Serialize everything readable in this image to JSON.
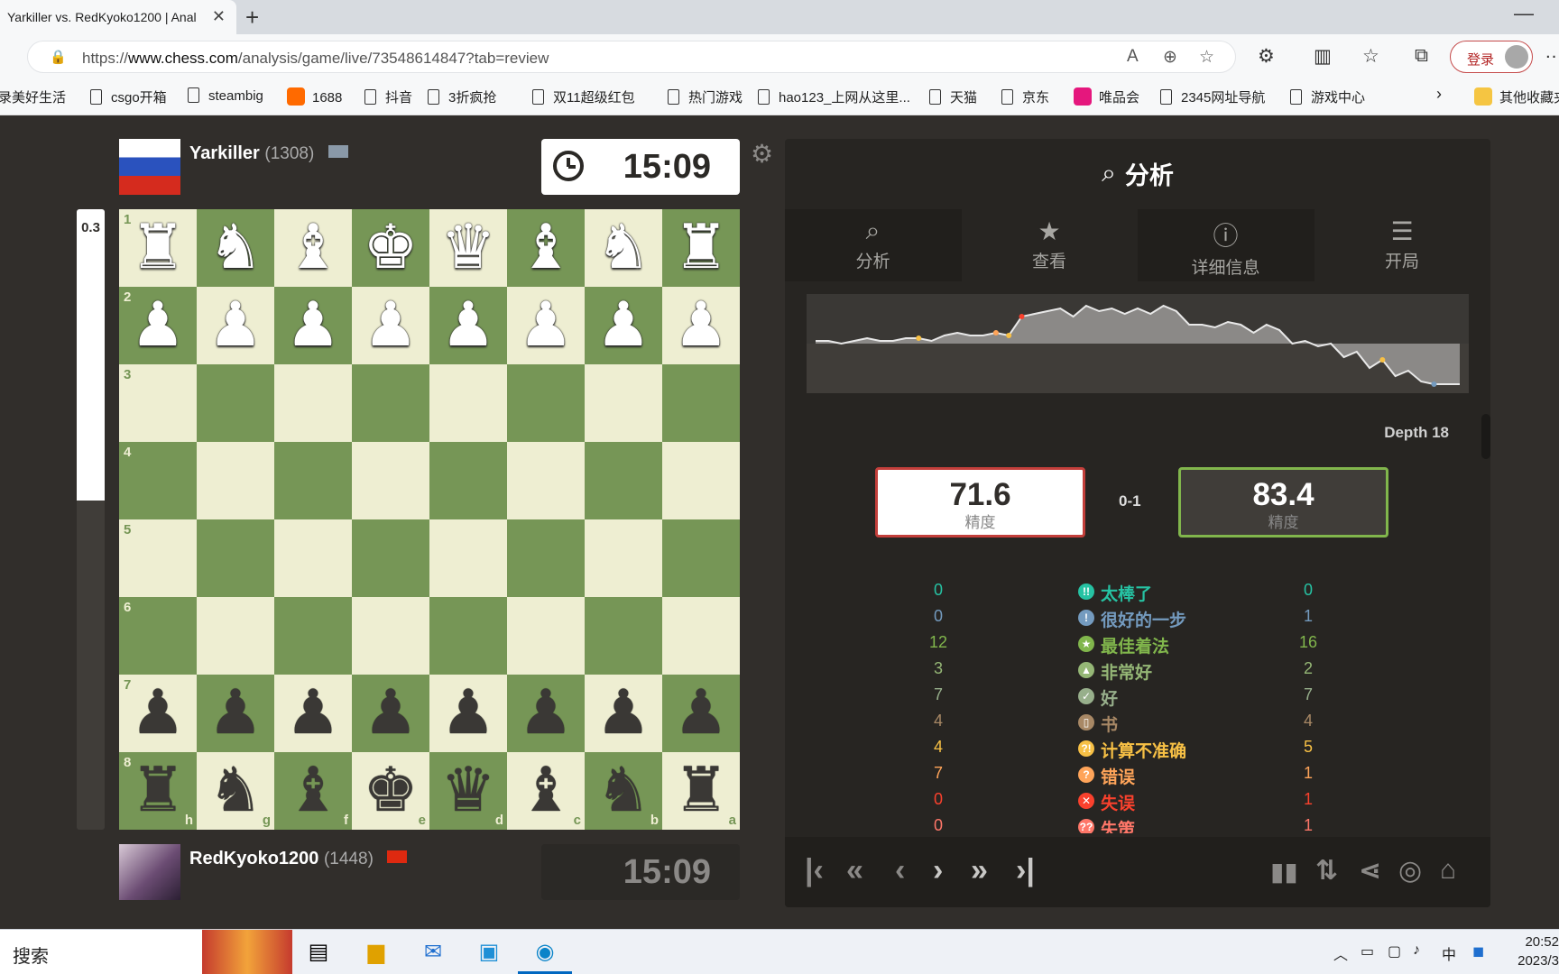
{
  "browser": {
    "tab_title": "Yarkiller vs. RedKyoko1200 | Anal",
    "url_prefix": "https://",
    "url_host": "www.chess.com",
    "url_path": "/analysis/game/live/73548614847?tab=review",
    "login_label": "登录",
    "bookmarks": [
      {
        "label": "录美好生活",
        "icon": "none"
      },
      {
        "label": "csgo开箱",
        "icon": "page-icon"
      },
      {
        "label": "steambig",
        "icon": "page-icon"
      },
      {
        "label": "1688",
        "icon": "1688-logo"
      },
      {
        "label": "抖音",
        "icon": "page-icon"
      },
      {
        "label": "3折疯抢",
        "icon": "page-icon"
      },
      {
        "label": "双11超级红包",
        "icon": "page-icon"
      },
      {
        "label": "热门游戏",
        "icon": "page-icon"
      },
      {
        "label": "hao123_上网从这里...",
        "icon": "page-icon"
      },
      {
        "label": "天猫",
        "icon": "page-icon"
      },
      {
        "label": "京东",
        "icon": "page-icon"
      },
      {
        "label": "唯品会",
        "icon": "vip-logo"
      },
      {
        "label": "2345网址导航",
        "icon": "page-icon"
      },
      {
        "label": "游戏中心",
        "icon": "page-icon"
      }
    ],
    "other_bookmarks": "其他收藏夹"
  },
  "top_player": {
    "name": "Yarkiller",
    "rating": "(1308)",
    "clock": "15:09"
  },
  "bottom_player": {
    "name": "RedKyoko1200",
    "rating": "(1448)",
    "clock": "15:09"
  },
  "eval": {
    "value": "0.3",
    "white_fraction": 0.47
  },
  "board": {
    "orientation": "black",
    "ranks": [
      "1",
      "2",
      "3",
      "4",
      "5",
      "6",
      "7",
      "8"
    ],
    "files": [
      "h",
      "g",
      "f",
      "e",
      "d",
      "c",
      "b",
      "a"
    ],
    "rows": [
      [
        "♜",
        "♞",
        "♝",
        "♚",
        "♛",
        "♝",
        "♞",
        "♜"
      ],
      [
        "♟",
        "♟",
        "♟",
        "♟",
        "♟",
        "♟",
        "♟",
        "♟"
      ],
      [
        "",
        "",
        "",
        "",
        "",
        "",
        "",
        ""
      ],
      [
        "",
        "",
        "",
        "",
        "",
        "",
        "",
        ""
      ],
      [
        "",
        "",
        "",
        "",
        "",
        "",
        "",
        ""
      ],
      [
        "",
        "",
        "",
        "",
        "",
        "",
        "",
        ""
      ],
      [
        "♟",
        "♟",
        "♟",
        "♟",
        "♟",
        "♟",
        "♟",
        "♟"
      ],
      [
        "♜",
        "♞",
        "♝",
        "♚",
        "♛",
        "♝",
        "♞",
        "♜"
      ]
    ],
    "row_colors": [
      "w",
      "w",
      "",
      "",
      "",
      "",
      "b",
      "b"
    ]
  },
  "analysis": {
    "title": "分析",
    "tabs": [
      {
        "label": "分析",
        "icon": "analysis-icon"
      },
      {
        "label": "查看",
        "icon": "star-icon"
      },
      {
        "label": "详细信息",
        "icon": "info-icon"
      },
      {
        "label": "开局",
        "icon": "book-icon"
      }
    ],
    "depth": "Depth 18",
    "white_accuracy": "71.6",
    "black_accuracy": "83.4",
    "accuracy_label": "精度",
    "score": "0-1",
    "eval_graph": [
      0.1,
      0.1,
      0.0,
      0.1,
      0.2,
      0.1,
      0.1,
      0.2,
      0.2,
      0.1,
      0.3,
      0.4,
      0.3,
      0.3,
      0.4,
      0.3,
      1.0,
      1.1,
      1.2,
      1.3,
      1.0,
      1.4,
      1.2,
      1.3,
      1.1,
      1.3,
      1.1,
      1.4,
      1.2,
      0.7,
      0.7,
      0.6,
      0.8,
      0.7,
      0.4,
      0.7,
      0.5,
      0.0,
      0.1,
      -0.1,
      0.0,
      -0.5,
      -0.3,
      -0.9,
      -0.6,
      -1.2,
      -1.0,
      -1.4,
      -1.5,
      -1.5,
      -1.5
    ],
    "classifications": [
      {
        "label": "太棒了",
        "white": "0",
        "black": "0",
        "color": "#26c2a3",
        "glyph": "!!"
      },
      {
        "label": "很好的一步",
        "white": "0",
        "black": "1",
        "color": "#749bbf",
        "glyph": "!"
      },
      {
        "label": "最佳着法",
        "white": "12",
        "black": "16",
        "color": "#81b64c",
        "glyph": "★"
      },
      {
        "label": "非常好",
        "white": "3",
        "black": "2",
        "color": "#95b776",
        "glyph": "▲"
      },
      {
        "label": "好",
        "white": "7",
        "black": "7",
        "color": "#97af8b",
        "glyph": "✓"
      },
      {
        "label": "书",
        "white": "4",
        "black": "4",
        "color": "#a88865",
        "glyph": "▯"
      },
      {
        "label": "计算不准确",
        "white": "4",
        "black": "5",
        "color": "#f7c045",
        "glyph": "?!"
      },
      {
        "label": "错误",
        "white": "7",
        "black": "1",
        "color": "#ffa459",
        "glyph": "?"
      },
      {
        "label": "失误",
        "white": "0",
        "black": "1",
        "color": "#fa412d",
        "glyph": "✕"
      },
      {
        "label": "失策",
        "white": "0",
        "black": "1",
        "color": "#ff7769",
        "glyph": "??"
      }
    ]
  },
  "taskbar": {
    "search": "搜索",
    "time": "20:52",
    "date": "2023/3",
    "ime": "中"
  }
}
